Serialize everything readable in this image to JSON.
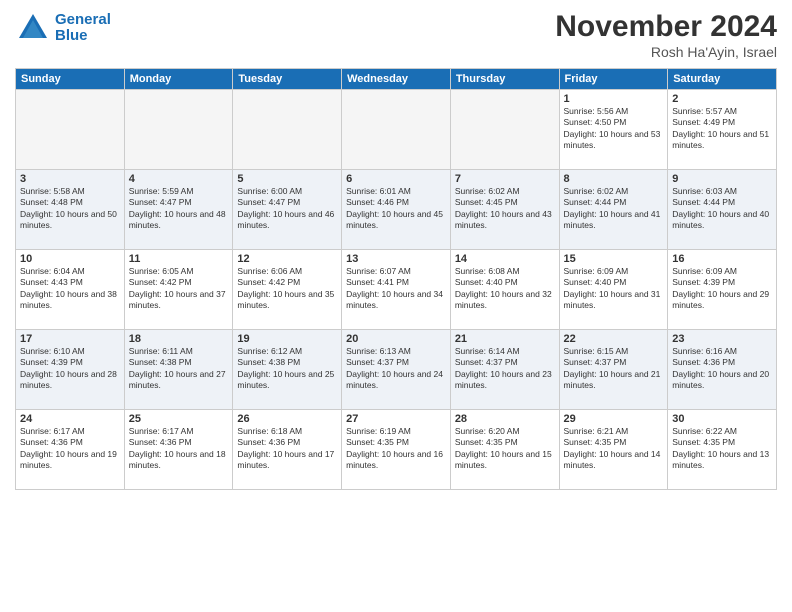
{
  "logo": {
    "text_line1": "General",
    "text_line2": "Blue"
  },
  "header": {
    "month": "November 2024",
    "location": "Rosh Ha'Ayin, Israel"
  },
  "weekdays": [
    "Sunday",
    "Monday",
    "Tuesday",
    "Wednesday",
    "Thursday",
    "Friday",
    "Saturday"
  ],
  "weeks": [
    [
      {
        "day": "",
        "empty": true
      },
      {
        "day": "",
        "empty": true
      },
      {
        "day": "",
        "empty": true
      },
      {
        "day": "",
        "empty": true
      },
      {
        "day": "",
        "empty": true
      },
      {
        "day": "1",
        "sunrise": "5:56 AM",
        "sunset": "4:50 PM",
        "daylight": "10 hours and 53 minutes."
      },
      {
        "day": "2",
        "sunrise": "5:57 AM",
        "sunset": "4:49 PM",
        "daylight": "10 hours and 51 minutes."
      }
    ],
    [
      {
        "day": "3",
        "sunrise": "5:58 AM",
        "sunset": "4:48 PM",
        "daylight": "10 hours and 50 minutes."
      },
      {
        "day": "4",
        "sunrise": "5:59 AM",
        "sunset": "4:47 PM",
        "daylight": "10 hours and 48 minutes."
      },
      {
        "day": "5",
        "sunrise": "6:00 AM",
        "sunset": "4:47 PM",
        "daylight": "10 hours and 46 minutes."
      },
      {
        "day": "6",
        "sunrise": "6:01 AM",
        "sunset": "4:46 PM",
        "daylight": "10 hours and 45 minutes."
      },
      {
        "day": "7",
        "sunrise": "6:02 AM",
        "sunset": "4:45 PM",
        "daylight": "10 hours and 43 minutes."
      },
      {
        "day": "8",
        "sunrise": "6:02 AM",
        "sunset": "4:44 PM",
        "daylight": "10 hours and 41 minutes."
      },
      {
        "day": "9",
        "sunrise": "6:03 AM",
        "sunset": "4:44 PM",
        "daylight": "10 hours and 40 minutes."
      }
    ],
    [
      {
        "day": "10",
        "sunrise": "6:04 AM",
        "sunset": "4:43 PM",
        "daylight": "10 hours and 38 minutes."
      },
      {
        "day": "11",
        "sunrise": "6:05 AM",
        "sunset": "4:42 PM",
        "daylight": "10 hours and 37 minutes."
      },
      {
        "day": "12",
        "sunrise": "6:06 AM",
        "sunset": "4:42 PM",
        "daylight": "10 hours and 35 minutes."
      },
      {
        "day": "13",
        "sunrise": "6:07 AM",
        "sunset": "4:41 PM",
        "daylight": "10 hours and 34 minutes."
      },
      {
        "day": "14",
        "sunrise": "6:08 AM",
        "sunset": "4:40 PM",
        "daylight": "10 hours and 32 minutes."
      },
      {
        "day": "15",
        "sunrise": "6:09 AM",
        "sunset": "4:40 PM",
        "daylight": "10 hours and 31 minutes."
      },
      {
        "day": "16",
        "sunrise": "6:09 AM",
        "sunset": "4:39 PM",
        "daylight": "10 hours and 29 minutes."
      }
    ],
    [
      {
        "day": "17",
        "sunrise": "6:10 AM",
        "sunset": "4:39 PM",
        "daylight": "10 hours and 28 minutes."
      },
      {
        "day": "18",
        "sunrise": "6:11 AM",
        "sunset": "4:38 PM",
        "daylight": "10 hours and 27 minutes."
      },
      {
        "day": "19",
        "sunrise": "6:12 AM",
        "sunset": "4:38 PM",
        "daylight": "10 hours and 25 minutes."
      },
      {
        "day": "20",
        "sunrise": "6:13 AM",
        "sunset": "4:37 PM",
        "daylight": "10 hours and 24 minutes."
      },
      {
        "day": "21",
        "sunrise": "6:14 AM",
        "sunset": "4:37 PM",
        "daylight": "10 hours and 23 minutes."
      },
      {
        "day": "22",
        "sunrise": "6:15 AM",
        "sunset": "4:37 PM",
        "daylight": "10 hours and 21 minutes."
      },
      {
        "day": "23",
        "sunrise": "6:16 AM",
        "sunset": "4:36 PM",
        "daylight": "10 hours and 20 minutes."
      }
    ],
    [
      {
        "day": "24",
        "sunrise": "6:17 AM",
        "sunset": "4:36 PM",
        "daylight": "10 hours and 19 minutes."
      },
      {
        "day": "25",
        "sunrise": "6:17 AM",
        "sunset": "4:36 PM",
        "daylight": "10 hours and 18 minutes."
      },
      {
        "day": "26",
        "sunrise": "6:18 AM",
        "sunset": "4:36 PM",
        "daylight": "10 hours and 17 minutes."
      },
      {
        "day": "27",
        "sunrise": "6:19 AM",
        "sunset": "4:35 PM",
        "daylight": "10 hours and 16 minutes."
      },
      {
        "day": "28",
        "sunrise": "6:20 AM",
        "sunset": "4:35 PM",
        "daylight": "10 hours and 15 minutes."
      },
      {
        "day": "29",
        "sunrise": "6:21 AM",
        "sunset": "4:35 PM",
        "daylight": "10 hours and 14 minutes."
      },
      {
        "day": "30",
        "sunrise": "6:22 AM",
        "sunset": "4:35 PM",
        "daylight": "10 hours and 13 minutes."
      }
    ]
  ]
}
